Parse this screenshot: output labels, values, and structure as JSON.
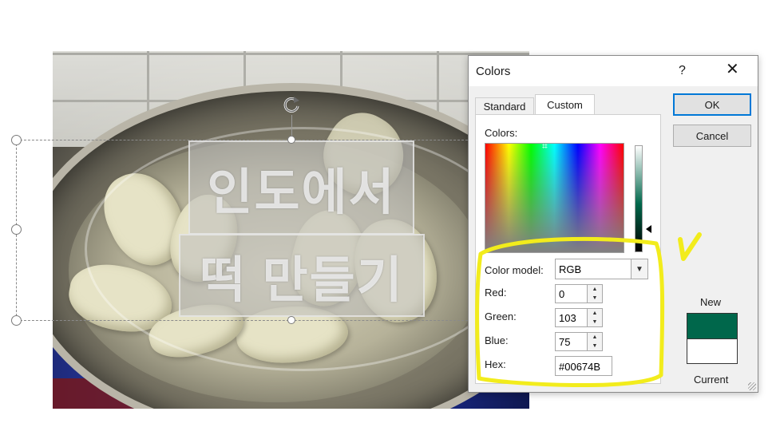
{
  "slide": {
    "title_line_1": "인도에서",
    "title_line_2": "떡 만들기"
  },
  "dialog": {
    "title": "Colors",
    "help_label": "?",
    "close_label": "✕",
    "tabs": [
      {
        "label": "Standard",
        "active": false
      },
      {
        "label": "Custom",
        "active": true
      }
    ],
    "colors_label": "Colors:",
    "color_model_label": "Color model:",
    "color_model_value": "RGB",
    "red_label": "Red:",
    "red_value": "0",
    "green_label": "Green:",
    "green_value": "103",
    "blue_label": "Blue:",
    "blue_value": "75",
    "hex_label": "Hex:",
    "hex_value": "#00674B",
    "ok_label": "OK",
    "cancel_label": "Cancel",
    "new_label": "New",
    "current_label": "Current",
    "new_color": "#00674B",
    "current_color": "#ffffff"
  },
  "annotation": {
    "highlight_color": "#f2ec1c",
    "checkmark": "✓"
  }
}
